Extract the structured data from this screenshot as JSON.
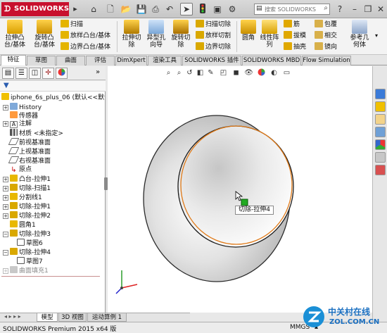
{
  "app": {
    "logo_text": "SOLIDWORKS"
  },
  "search": {
    "placeholder": "搜索 SOLIDWORKS"
  },
  "commands": {
    "extrude_boss": "拉伸凸台/基体",
    "revolve_boss": "旋转凸台/基体",
    "sweep": "扫描",
    "loft_boss": "放样凸台/基体",
    "boundary_boss": "边界凸台/基体",
    "extrude_cut": "拉伸切除",
    "hole_wizard": "异型孔向导",
    "revolve_cut": "旋转切除",
    "swept_cut": "扫描切除",
    "lofted_cut": "放样切割",
    "boundary_cut": "边界切除",
    "fillet": "圆角",
    "linear_pattern": "线性阵列",
    "rib": "筋",
    "draft": "拔模",
    "shell": "抽壳",
    "wrap": "包覆",
    "intersect": "相交",
    "mirror": "镜向",
    "ref_geometry": "参考几何体"
  },
  "tabs": [
    "特征",
    "草图",
    "曲面",
    "评估",
    "DimXpert",
    "渲染工具",
    "SOLIDWORKS 插件",
    "SOLIDWORKS MBD",
    "Flow Simulation"
  ],
  "tree": {
    "root": "iphone_6s_plus_06  (默认<<默认",
    "items": [
      "History",
      "传感器",
      "注解",
      "材质 <未指定>",
      "前视基准面",
      "上视基准面",
      "右视基准面",
      "原点",
      "凸台-拉伸1",
      "切除-扫描1",
      "分割线1",
      "切除-拉伸1",
      "切除-拉伸2",
      "圆角1",
      "切除-拉伸3",
      "草图6",
      "切除-拉伸4",
      "草图7",
      "曲面填充1"
    ]
  },
  "viewport": {
    "tooltip": "切除-拉伸4"
  },
  "model_tabs": [
    "模型",
    "3D 视图",
    "运动算例 1"
  ],
  "status": {
    "left": "SOLIDWORKS Premium 2015 x64 版",
    "units": "MMGS"
  },
  "watermark": {
    "brand": "中关村在线",
    "url": "ZOL.COM.CN"
  },
  "colors": {
    "brand_red": "#c8102e",
    "edge_highlight": "#e07a18",
    "selected_green": "#22aa22"
  }
}
